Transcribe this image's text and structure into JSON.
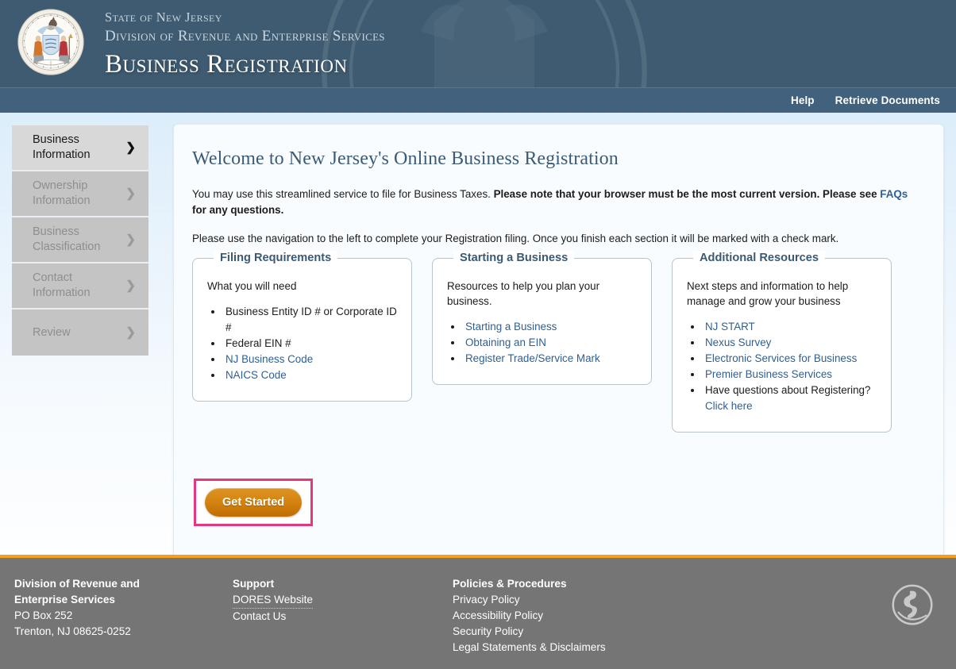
{
  "masthead": {
    "seal_icon": "nj-state-seal-icon",
    "line1": "State of New Jersey",
    "line2": "Division of Revenue and Enterprise Services",
    "line3": "Business Registration"
  },
  "utility_nav": {
    "items": [
      {
        "label": "Help"
      },
      {
        "label": "Retrieve Documents"
      }
    ]
  },
  "sidebar": {
    "items": [
      {
        "label": "Business Information",
        "active": true,
        "chevron_icon": "chevron-right-icon"
      },
      {
        "label": "Ownership Information",
        "active": false,
        "chevron_icon": "chevron-right-icon"
      },
      {
        "label": "Business Classification",
        "active": false,
        "chevron_icon": "chevron-right-icon"
      },
      {
        "label": "Contact Information",
        "active": false,
        "chevron_icon": "chevron-right-icon"
      },
      {
        "label": "Review",
        "active": false,
        "chevron_icon": "chevron-right-icon"
      }
    ]
  },
  "main": {
    "title": "Welcome to New Jersey's Online Business Registration",
    "intro_1_plain": "You may use this streamlined service to file for Business Taxes. ",
    "intro_1_bold": "Please note that your browser must be the most current version. Please see ",
    "intro_1_link": "FAQs",
    "intro_1_tail": " for any questions.",
    "intro_2": "Please use the navigation to the left to complete your Registration filing. Once you finish each section it will be marked with a check mark.",
    "panels": [
      {
        "legend": "Filing Requirements",
        "intro": "What you will need",
        "items": [
          {
            "text": "Business Entity ID # or Corporate ID #",
            "link": false
          },
          {
            "text": "Federal EIN #",
            "link": false
          },
          {
            "text": "NJ Business Code",
            "link": true
          },
          {
            "text": "NAICS Code",
            "link": true
          }
        ]
      },
      {
        "legend": "Starting a Business",
        "intro": "Resources to help you plan your business.",
        "items": [
          {
            "text": "Starting a Business",
            "link": true
          },
          {
            "text": "Obtaining an EIN",
            "link": true
          },
          {
            "text": "Register Trade/Service Mark",
            "link": true
          }
        ]
      },
      {
        "legend": "Additional Resources",
        "intro": "Next steps and information to help manage and grow your business",
        "items": [
          {
            "text": "NJ START",
            "link": true
          },
          {
            "text": "Nexus Survey",
            "link": true
          },
          {
            "text": "Electronic Services for Business",
            "link": true
          },
          {
            "text": "Premier Business Services",
            "link": true
          },
          {
            "text": "Have questions about Registering? ",
            "link": false,
            "trailing_link": "Click here"
          }
        ]
      }
    ],
    "get_started_label": "Get Started"
  },
  "footer": {
    "col1": {
      "heading_line1": "Division of Revenue and",
      "heading_line2": "Enterprise Services",
      "address_line1": "PO Box 252",
      "address_line2": "Trenton, NJ 08625-0252"
    },
    "col2": {
      "heading": "Support",
      "links": [
        {
          "label": "DORES Website",
          "dotted": true
        },
        {
          "label": "Contact Us",
          "dotted": false
        }
      ]
    },
    "col3": {
      "heading": "Policies & Procedures",
      "links": [
        {
          "label": "Privacy Policy"
        },
        {
          "label": "Accessibility Policy"
        },
        {
          "label": "Security Policy"
        },
        {
          "label": "Legal Statements & Disclaimers"
        }
      ]
    },
    "logo_icon": "nj-outline-circle-logo-icon"
  },
  "colors": {
    "header_bg": "#3e5b71",
    "utility_nav_bg": "#42617d",
    "page_bg_top": "#dcedfb",
    "heading_blue": "#3c5b76",
    "link_blue": "#2e6094",
    "cta_orange": "#d4840f",
    "highlight_pink": "#e5377f",
    "footer_bg": "#757575",
    "footer_rule_orange": "#f5a01c"
  }
}
